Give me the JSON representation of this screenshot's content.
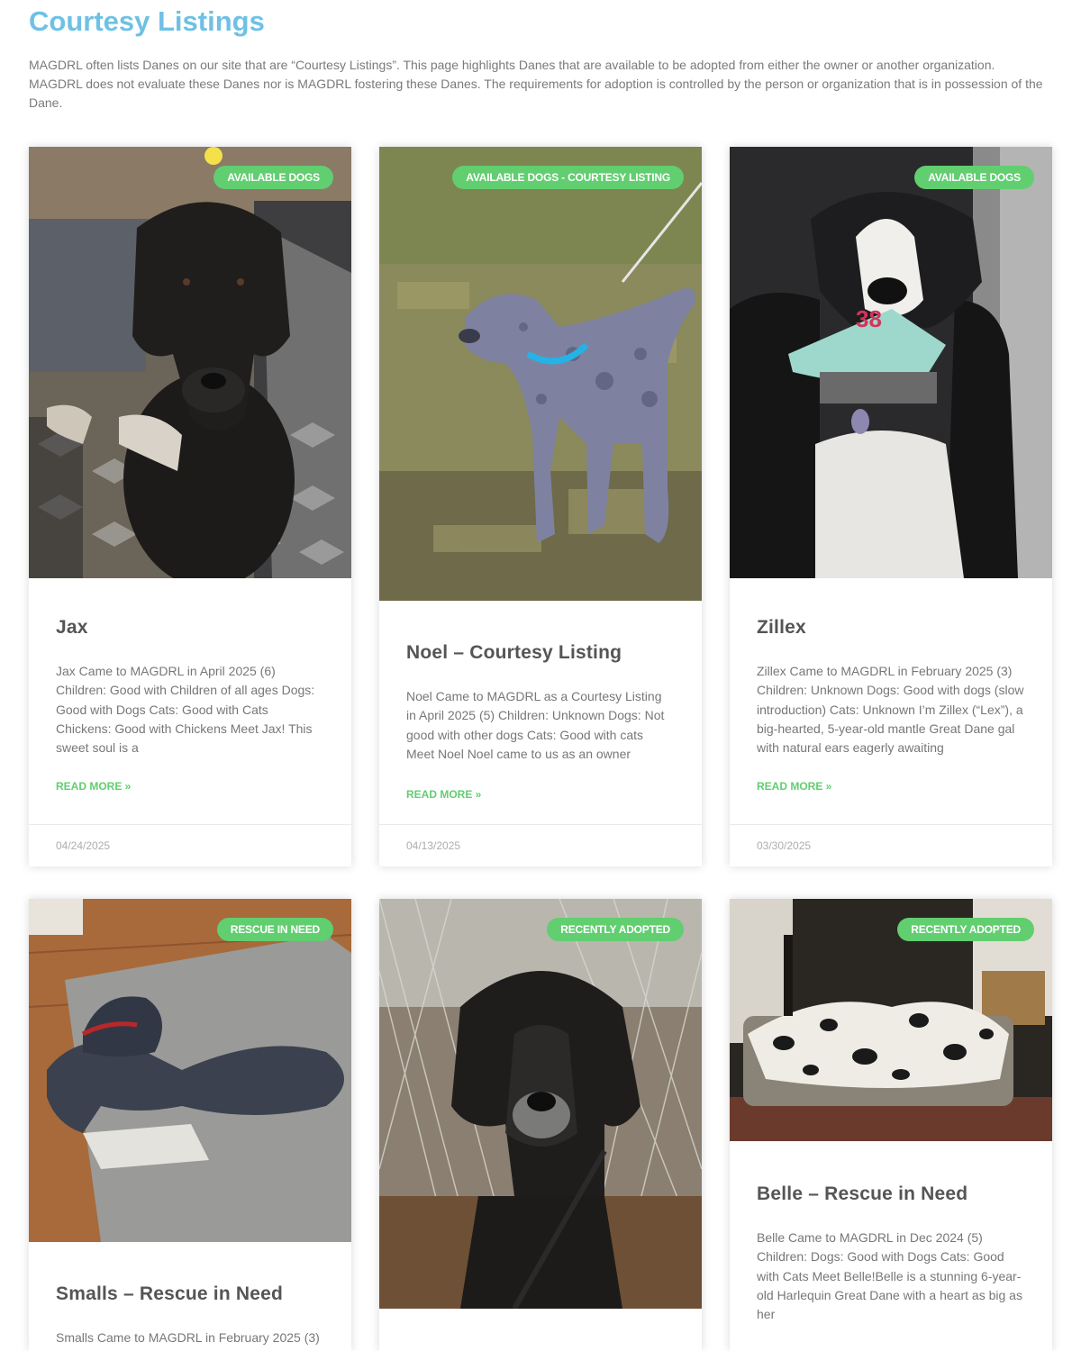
{
  "page": {
    "title": "Courtesy Listings",
    "intro": "MAGDRL often lists Danes on our site that are “Courtesy Listings”.  This page highlights Danes that are available to be adopted from either the owner or another organization.  MAGDRL does not evaluate these Danes nor is MAGDRL fostering these Danes.  The requirements for adoption is controlled by the person or organization that is in possession of the Dane."
  },
  "colors": {
    "title": "#6ec1e4",
    "badge": "#61ce70",
    "read_more": "#61ce70"
  },
  "posts": [
    {
      "badge": "Available Dogs",
      "title": "Jax",
      "excerpt": "Jax Came to MAGDRL in April 2025 (6) Children: Good with Children of all ages Dogs: Good with Dogs Cats: Good with Cats Chickens: Good with Chickens Meet Jax! This sweet soul is a",
      "read_more": "Read More »",
      "date": "04/24/2025",
      "image_alt": "black dog on patterned couch"
    },
    {
      "badge": "Available Dogs - Courtesy Listing",
      "title": "Noel – Courtesy Listing",
      "excerpt": "Noel Came to MAGDRL as a Courtesy Listing in April 2025 (5) Children: Unknown Dogs: Not good with other dogs Cats: Good with cats Meet Noel Noel came to us as an owner",
      "read_more": "Read More »",
      "date": "04/13/2025",
      "image_alt": "merle dog standing on grass"
    },
    {
      "badge": "Available Dogs",
      "title": "Zillex",
      "excerpt": "Zillex Came to MAGDRL in February 2025 (3) Children: Unknown Dogs: Good with dogs (slow introduction) Cats: Unknown I’m Zillex (“Lex”), a big-hearted, 5-year-old mantle Great Dane gal with natural ears eagerly awaiting",
      "read_more": "Read More »",
      "date": "03/30/2025",
      "image_alt": "mantle dane with bandana"
    },
    {
      "badge": "Rescue In Need",
      "title": "Smalls – Rescue in Need",
      "excerpt": "Smalls Came to MAGDRL in February 2025 (3)",
      "image_alt": "dark dog lying on rug"
    },
    {
      "badge": "Recently Adopted",
      "title": "",
      "excerpt": "",
      "image_alt": "dark dog sitting by fence"
    },
    {
      "badge": "Recently Adopted",
      "title": "Belle – Rescue in Need",
      "excerpt": "Belle Came to MAGDRL in Dec 2024 (5) Children: Dogs: Good with Dogs Cats: Good with Cats Meet Belle!Belle is a stunning 6-year-old Harlequin Great Dane with a heart as big as her",
      "image_alt": "harlequin danes on dog bed"
    }
  ]
}
